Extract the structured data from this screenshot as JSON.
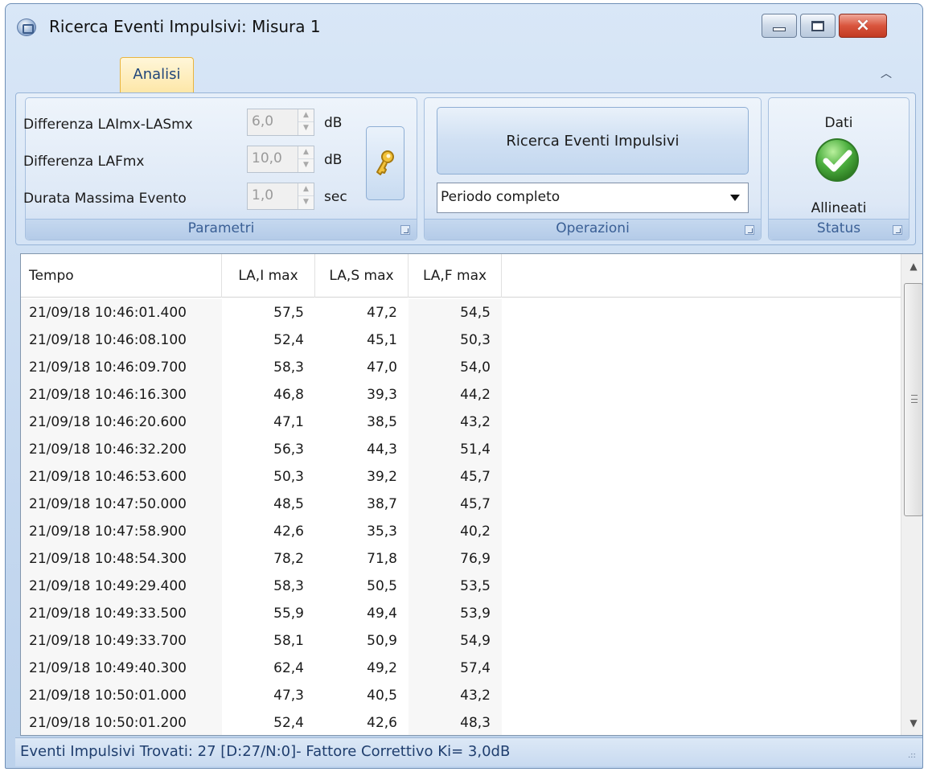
{
  "window": {
    "title": "Ricerca Eventi Impulsivi: Misura 1",
    "controls": {
      "minimize": "minimize-icon",
      "maximize": "maximize-icon",
      "close": "×"
    }
  },
  "ribbon": {
    "tab": "Analisi",
    "collapse_glyph": "︿",
    "parametri": {
      "label": "Parametri",
      "rows": [
        {
          "label": "Differenza LAImx-LASmx",
          "value": "6,0",
          "unit": "dB"
        },
        {
          "label": "Differenza LAFmx",
          "value": "10,0",
          "unit": "dB"
        },
        {
          "label": "Durata Massima Evento",
          "value": "1,0",
          "unit": "sec"
        }
      ]
    },
    "operazioni": {
      "label": "Operazioni",
      "search_button": "Ricerca Eventi Impulsivi",
      "period_select": "Periodo completo"
    },
    "status": {
      "label": "Status",
      "title": "Dati",
      "value": "Allineati",
      "icon": "check-circle-icon",
      "icon_color": "#4caf3f"
    }
  },
  "grid": {
    "columns": [
      "Tempo",
      "LA,I max",
      "LA,S max",
      "LA,F max"
    ],
    "rows": [
      [
        "21/09/18 10:46:01.400",
        "57,5",
        "47,2",
        "54,5"
      ],
      [
        "21/09/18 10:46:08.100",
        "52,4",
        "45,1",
        "50,3"
      ],
      [
        "21/09/18 10:46:09.700",
        "58,3",
        "47,0",
        "54,0"
      ],
      [
        "21/09/18 10:46:16.300",
        "46,8",
        "39,3",
        "44,2"
      ],
      [
        "21/09/18 10:46:20.600",
        "47,1",
        "38,5",
        "43,2"
      ],
      [
        "21/09/18 10:46:32.200",
        "56,3",
        "44,3",
        "51,4"
      ],
      [
        "21/09/18 10:46:53.600",
        "50,3",
        "39,2",
        "45,7"
      ],
      [
        "21/09/18 10:47:50.000",
        "48,5",
        "38,7",
        "45,7"
      ],
      [
        "21/09/18 10:47:58.900",
        "42,6",
        "35,3",
        "40,2"
      ],
      [
        "21/09/18 10:48:54.300",
        "78,2",
        "71,8",
        "76,9"
      ],
      [
        "21/09/18 10:49:29.400",
        "58,3",
        "50,5",
        "53,5"
      ],
      [
        "21/09/18 10:49:33.500",
        "55,9",
        "49,4",
        "53,9"
      ],
      [
        "21/09/18 10:49:33.700",
        "58,1",
        "50,9",
        "54,9"
      ],
      [
        "21/09/18 10:49:40.300",
        "62,4",
        "49,2",
        "57,4"
      ],
      [
        "21/09/18 10:50:01.000",
        "47,3",
        "40,5",
        "43,2"
      ],
      [
        "21/09/18 10:50:01.200",
        "52,4",
        "42,6",
        "48,3"
      ]
    ]
  },
  "statusbar": {
    "text": "Eventi Impulsivi Trovati: 27 [D:27/N:0]- Fattore Correttivo Ki= 3,0dB"
  }
}
